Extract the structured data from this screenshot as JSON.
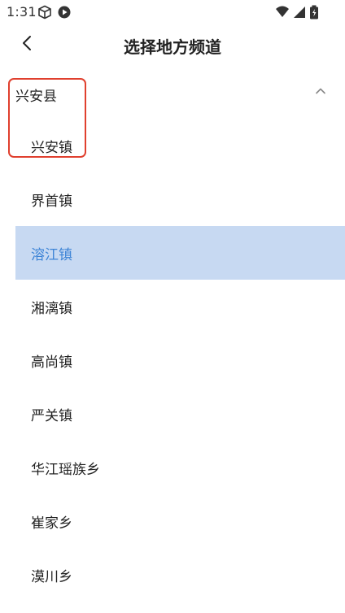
{
  "status_bar": {
    "time": "1:31",
    "left_icons": [
      "cube-icon",
      "play-circle-icon"
    ],
    "right_icons": [
      "wifi-icon",
      "signal-icon",
      "battery-icon"
    ]
  },
  "header": {
    "back_icon": "chevron-left-icon",
    "title": "选择地方频道"
  },
  "group": {
    "title": "兴安县",
    "expanded": true,
    "toggle_icon": "chevron-up-icon"
  },
  "towns": [
    {
      "label": "兴安镇",
      "selected": false
    },
    {
      "label": "界首镇",
      "selected": false
    },
    {
      "label": "溶江镇",
      "selected": true
    },
    {
      "label": "湘漓镇",
      "selected": false
    },
    {
      "label": "高尚镇",
      "selected": false
    },
    {
      "label": "严关镇",
      "selected": false
    },
    {
      "label": "华江瑶族乡",
      "selected": false
    },
    {
      "label": "崔家乡",
      "selected": false
    },
    {
      "label": "漠川乡",
      "selected": false
    }
  ],
  "colors": {
    "selected_background": "#c7d9f2",
    "selected_text": "#3d84d6",
    "annotation_border": "#e0402e"
  }
}
